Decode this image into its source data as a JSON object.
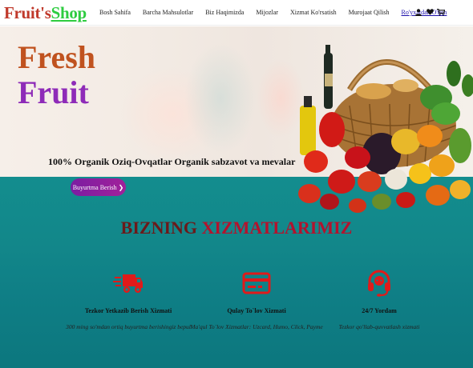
{
  "brand": {
    "part1": "Fruit's",
    "part2": "Shop"
  },
  "nav": {
    "items": [
      "Bosh Sahifa",
      "Barcha Mahsulotlar",
      "Biz Haqimizda",
      "Mijozlar",
      "Xizmat Ko'rsatish",
      "Murojaat Qilish"
    ],
    "login": "Ro'yxatdan O'tish",
    "icons": [
      "user-icon",
      "heart-icon",
      "cart-icon"
    ]
  },
  "hero": {
    "title_line1": "Fresh",
    "title_line2": "Fruit",
    "tagline": "100% Organik Oziq-Ovqatlar Organik sabzavot va mevalar",
    "button_label": "Buyurtma Berish ❯"
  },
  "services": {
    "title_part1": "BIZNING ",
    "title_part2": "XIZMATLARIMIZ",
    "items": [
      {
        "icon": "delivery-truck-icon",
        "name": "Tezkor Yetkazib Berish Xizmati",
        "desc": "300 ming so'mdan ortiq buyurtma berishingiz bepul"
      },
      {
        "icon": "payment-card-icon",
        "name": "Qulay To`lov Xizmati",
        "desc": "Ma'qul To`lov Xizmatlar: Uzcard, Humo, Click, Payme"
      },
      {
        "icon": "headset-support-icon",
        "name": "24/7 Yordam",
        "desc": "Tezkor qo'llab-quvvatlash xizmati"
      }
    ]
  },
  "colors": {
    "fresh": "#c0521f",
    "fruit": "#8e2bb8",
    "band": "#12878a",
    "button": "#8b1fa0",
    "title_dark": "#6b1a1a",
    "title_red": "#b3132d",
    "icon_red": "#e01a1a"
  }
}
